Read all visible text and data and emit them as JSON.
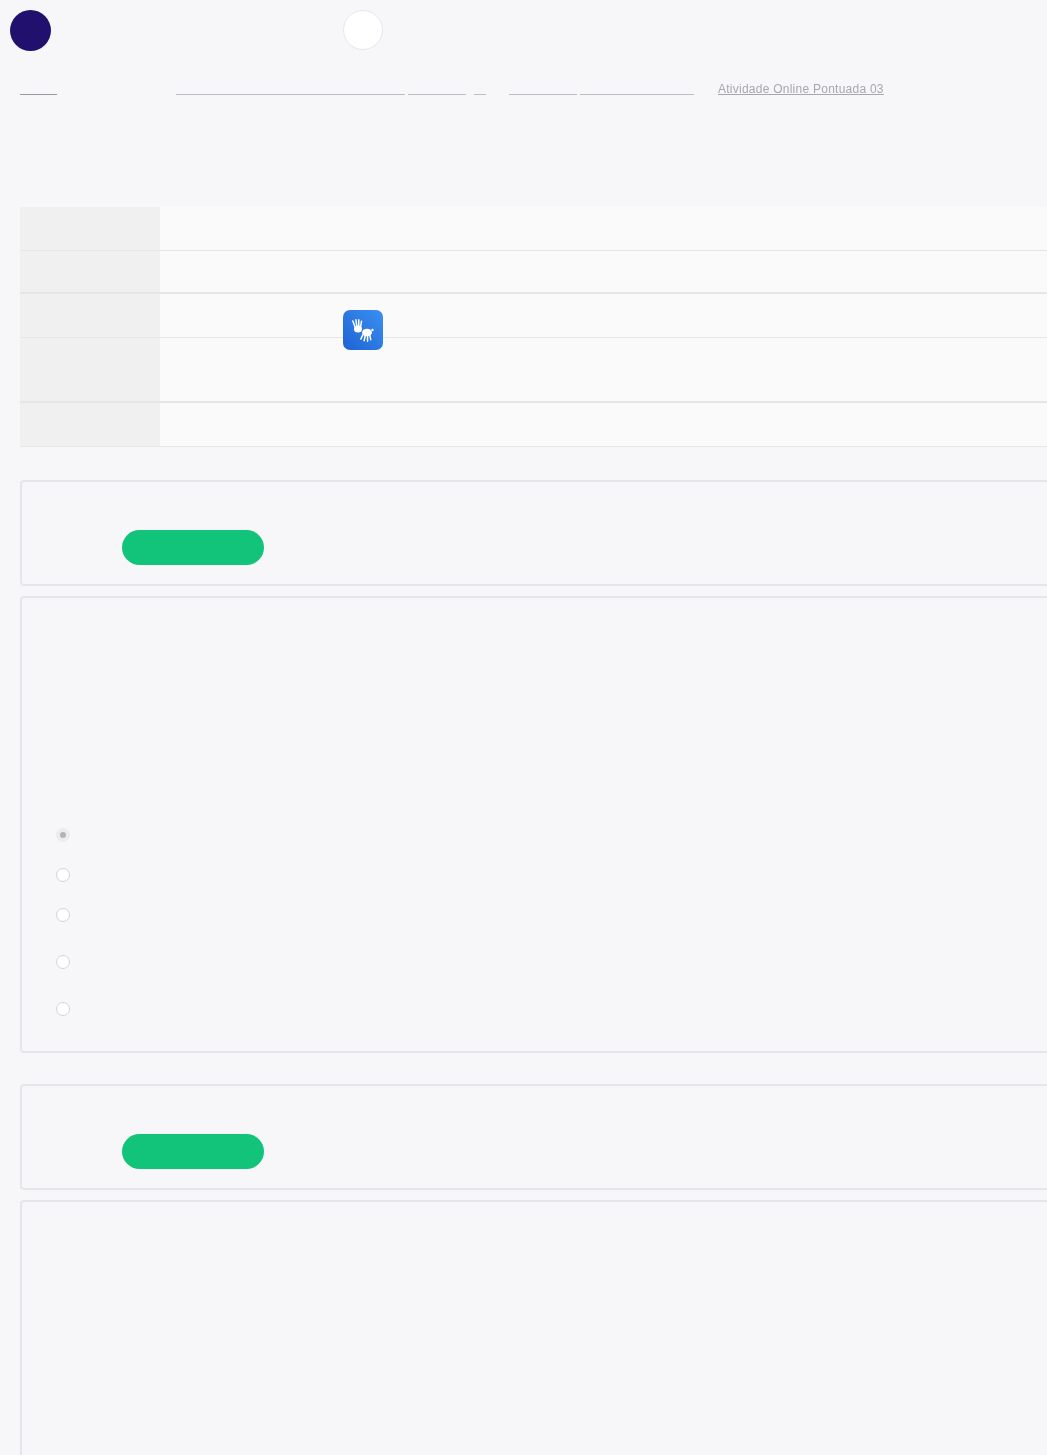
{
  "header": {
    "breadcrumb": {
      "current_link": "Atividade Online Pontuada 03"
    }
  },
  "cards": [
    {
      "kind": "action"
    },
    {
      "kind": "question",
      "options": [
        {
          "selected": true
        },
        {
          "selected": false
        },
        {
          "selected": false
        },
        {
          "selected": false
        },
        {
          "selected": false
        }
      ]
    },
    {
      "kind": "action"
    },
    {
      "kind": "question"
    }
  ]
}
